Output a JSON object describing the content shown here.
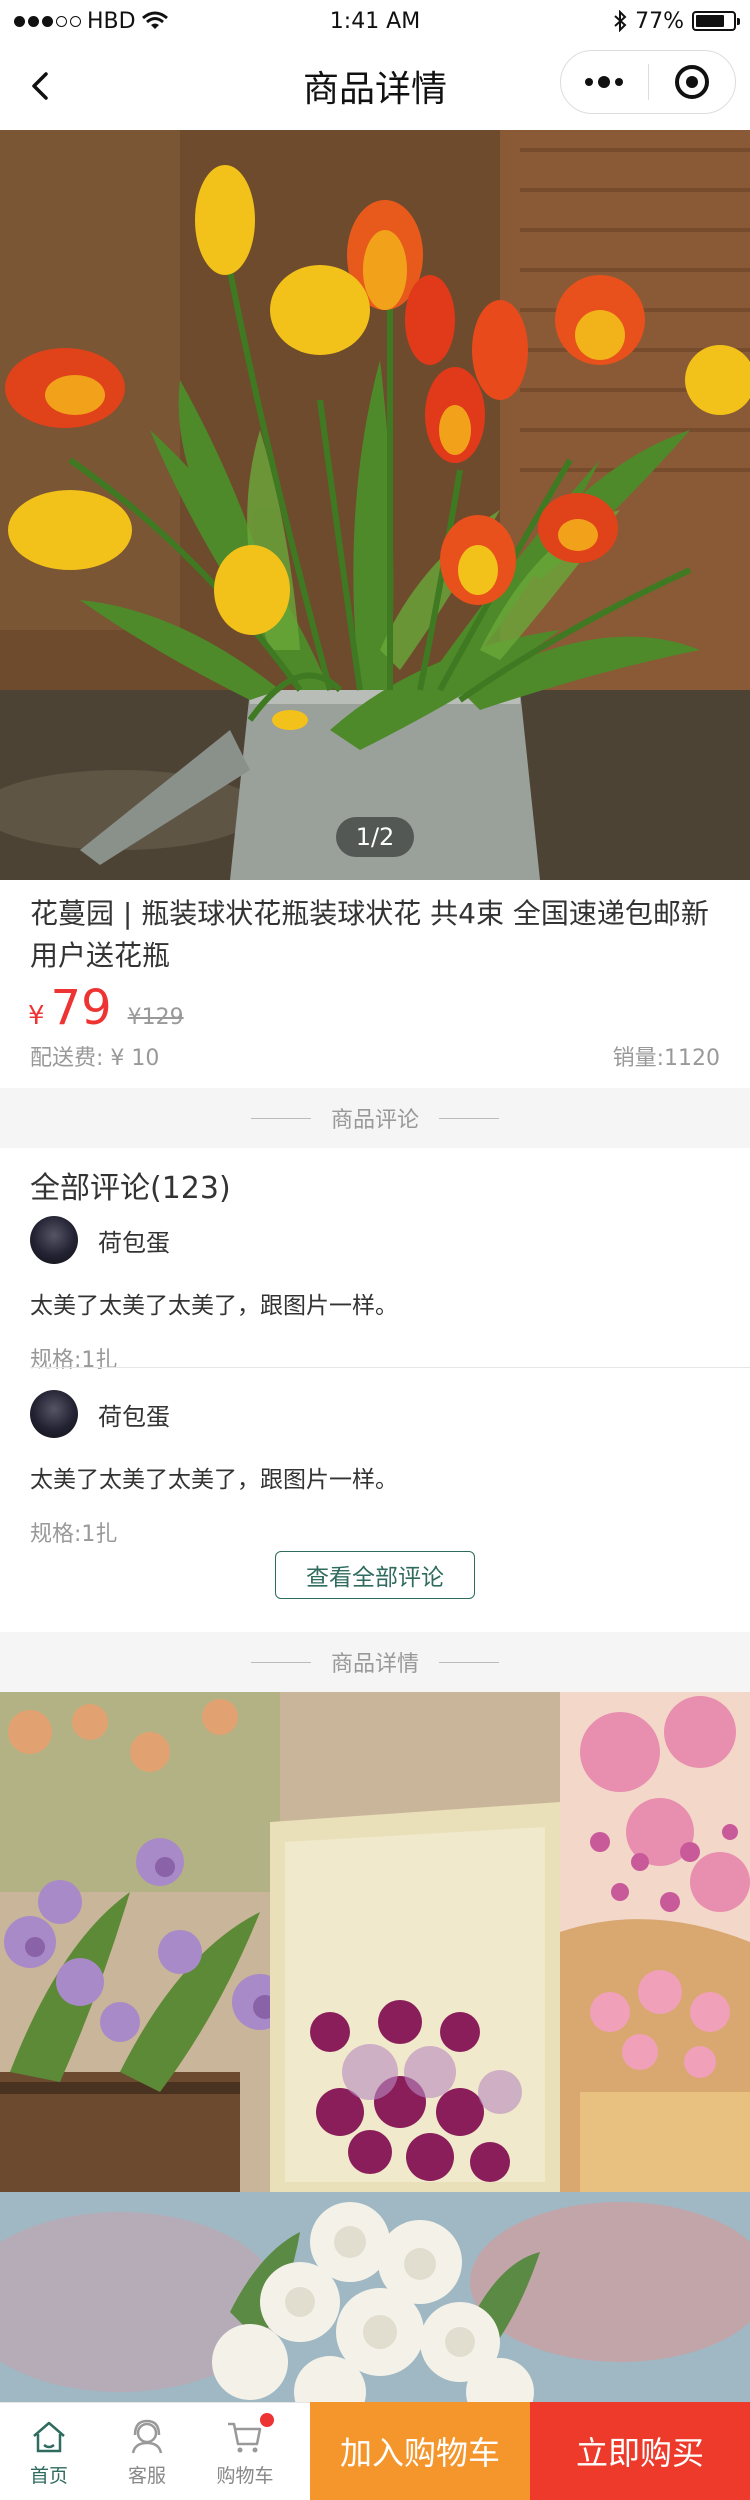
{
  "status": {
    "carrier": "HBD",
    "time": "1:41 AM",
    "battery": "77%",
    "battery_level": 0.77
  },
  "navbar": {
    "title": "商品详情"
  },
  "gallery": {
    "indicator": "1/2"
  },
  "product": {
    "title": "花蔓园 | 瓶装球状花瓶装球状花 共4束 全国速递包邮新用户送花瓶",
    "currency": "¥",
    "price": "79",
    "original_price": "¥129",
    "shipping": "配送费: ¥ 10",
    "sales": "销量:1120"
  },
  "reviews_section": {
    "label": "商品评论",
    "header": "全部评论(123)",
    "items": [
      {
        "user": "荷包蛋",
        "text": "太美了太美了太美了，跟图片一样。",
        "spec": "规格:1扎"
      },
      {
        "user": "荷包蛋",
        "text": "太美了太美了太美了，跟图片一样。",
        "spec": "规格:1扎"
      }
    ],
    "view_all": "查看全部评论"
  },
  "details_section": {
    "label": "商品详情"
  },
  "tabbar": {
    "home": "首页",
    "service": "客服",
    "cart": "购物车",
    "add_to_cart": "加入购物车",
    "buy_now": "立即购买"
  },
  "colors": {
    "accent": "#2f6b5e",
    "price": "#ee3333",
    "cart_button": "#f5962c",
    "buy_button": "#ee3a2b"
  }
}
